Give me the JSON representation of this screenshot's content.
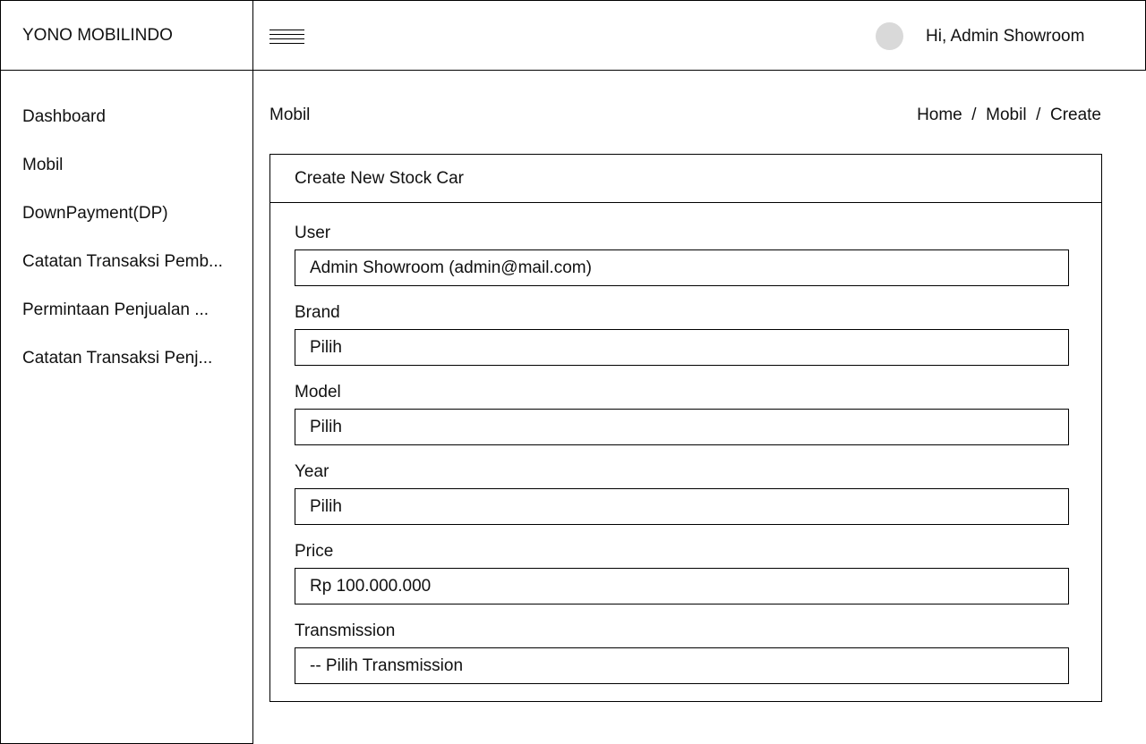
{
  "app": {
    "brand": "YONO MOBILINDO"
  },
  "header": {
    "greeting": "Hi, Admin Showroom",
    "icons": {
      "menu": "hamburger-menu-icon",
      "avatar": "user-avatar"
    }
  },
  "sidebar": {
    "items": [
      {
        "label": "Dashboard"
      },
      {
        "label": "Mobil"
      },
      {
        "label": "DownPayment(DP)"
      },
      {
        "label": "Catatan Transaksi Pemb..."
      },
      {
        "label": "Permintaan Penjualan ..."
      },
      {
        "label": "Catatan Transaksi Penj..."
      }
    ]
  },
  "main": {
    "title": "Mobil",
    "breadcrumb": {
      "home": "Home",
      "mobil": "Mobil",
      "create": "Create",
      "separator": "/"
    },
    "card": {
      "title": "Create New Stock Car"
    },
    "form": {
      "user": {
        "label": "User",
        "value": "Admin Showroom (admin@mail.com)"
      },
      "brand": {
        "label": "Brand",
        "value": "Pilih"
      },
      "model": {
        "label": "Model",
        "value": "Pilih"
      },
      "year": {
        "label": "Year",
        "value": "Pilih"
      },
      "price": {
        "label": "Price",
        "value": "Rp 100.000.000"
      },
      "transmission": {
        "label": "Transmission",
        "value": "-- Pilih Transmission"
      }
    }
  },
  "colors": {
    "border": "#000000",
    "avatar": "#d9d9d9",
    "background": "#ffffff",
    "text": "#111111"
  }
}
